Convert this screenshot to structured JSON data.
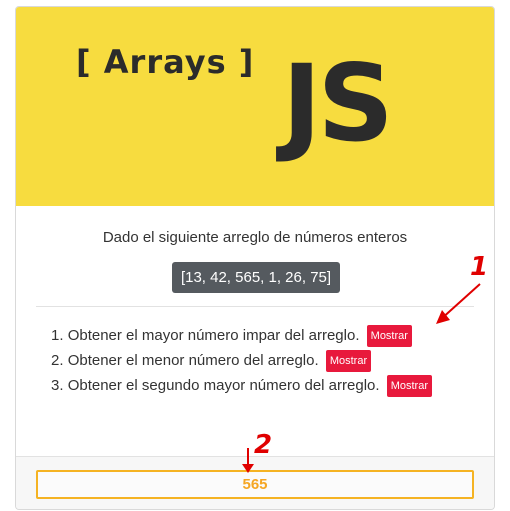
{
  "banner": {
    "arrays_label": "[ Arrays ]",
    "js_logo": "JS"
  },
  "content": {
    "intro": "Dado el siguiente arreglo de números enteros",
    "array_display": "[13, 42, 565, 1, 26, 75]",
    "tasks": [
      {
        "number": "1.",
        "text": "Obtener el mayor número impar del arreglo.",
        "button": "Mostrar"
      },
      {
        "number": "2.",
        "text": "Obtener el menor número del arreglo.",
        "button": "Mostrar"
      },
      {
        "number": "3.",
        "text": "Obtener el segundo mayor número del arreglo.",
        "button": "Mostrar"
      }
    ]
  },
  "footer": {
    "result": "565"
  },
  "annotations": {
    "marker_1": "1",
    "marker_2": "2"
  },
  "colors": {
    "banner_bg": "#f7dc3f",
    "button_bg": "#e8193c",
    "result_border": "#f5b323",
    "annotation": "#e00000"
  }
}
